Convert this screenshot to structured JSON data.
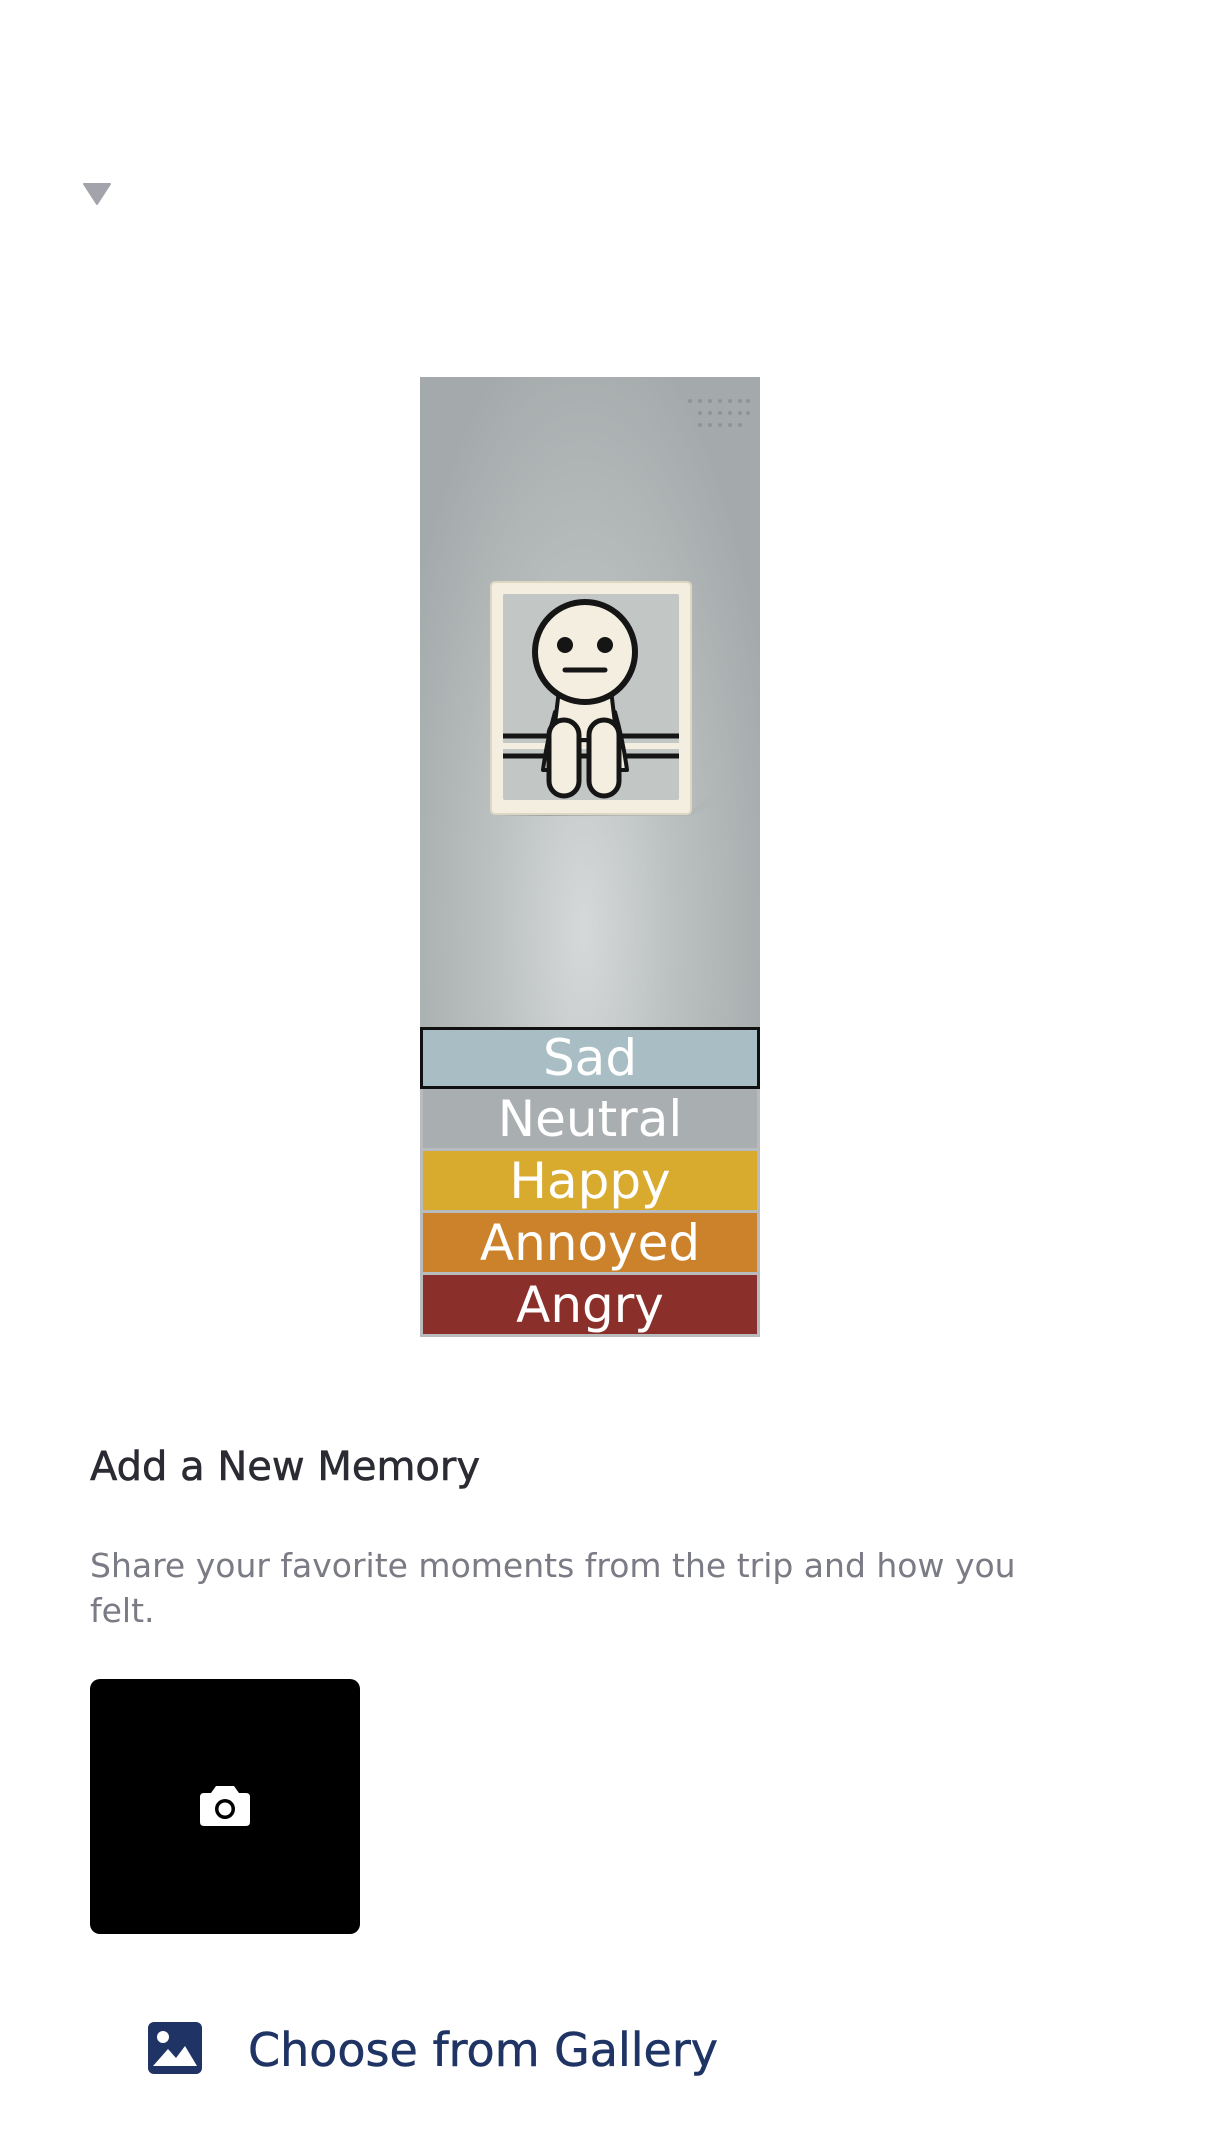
{
  "header": {
    "toggle_icon": "triangle-down-icon"
  },
  "mood_selector": {
    "illustration_icon": "neutral-figure-illustration",
    "selected": "Sad",
    "options": [
      {
        "label": "Sad",
        "color": "#a9bec4",
        "selected": true
      },
      {
        "label": "Neutral",
        "color": "#a9aeb0",
        "selected": false
      },
      {
        "label": "Happy",
        "color": "#d8aa2e",
        "selected": false
      },
      {
        "label": "Annoyed",
        "color": "#cc822a",
        "selected": false
      },
      {
        "label": "Angry",
        "color": "#8b2f2a",
        "selected": false
      }
    ]
  },
  "memory": {
    "title": "Add a New Memory",
    "description": "Share your favorite moments from the trip and how you felt.",
    "camera_icon": "camera-icon",
    "gallery_icon": "image-icon",
    "gallery_label": "Choose from Gallery"
  },
  "colors": {
    "accent": "#1f3464",
    "title_text": "#2b2b33",
    "secondary_text": "#7a7b84"
  }
}
